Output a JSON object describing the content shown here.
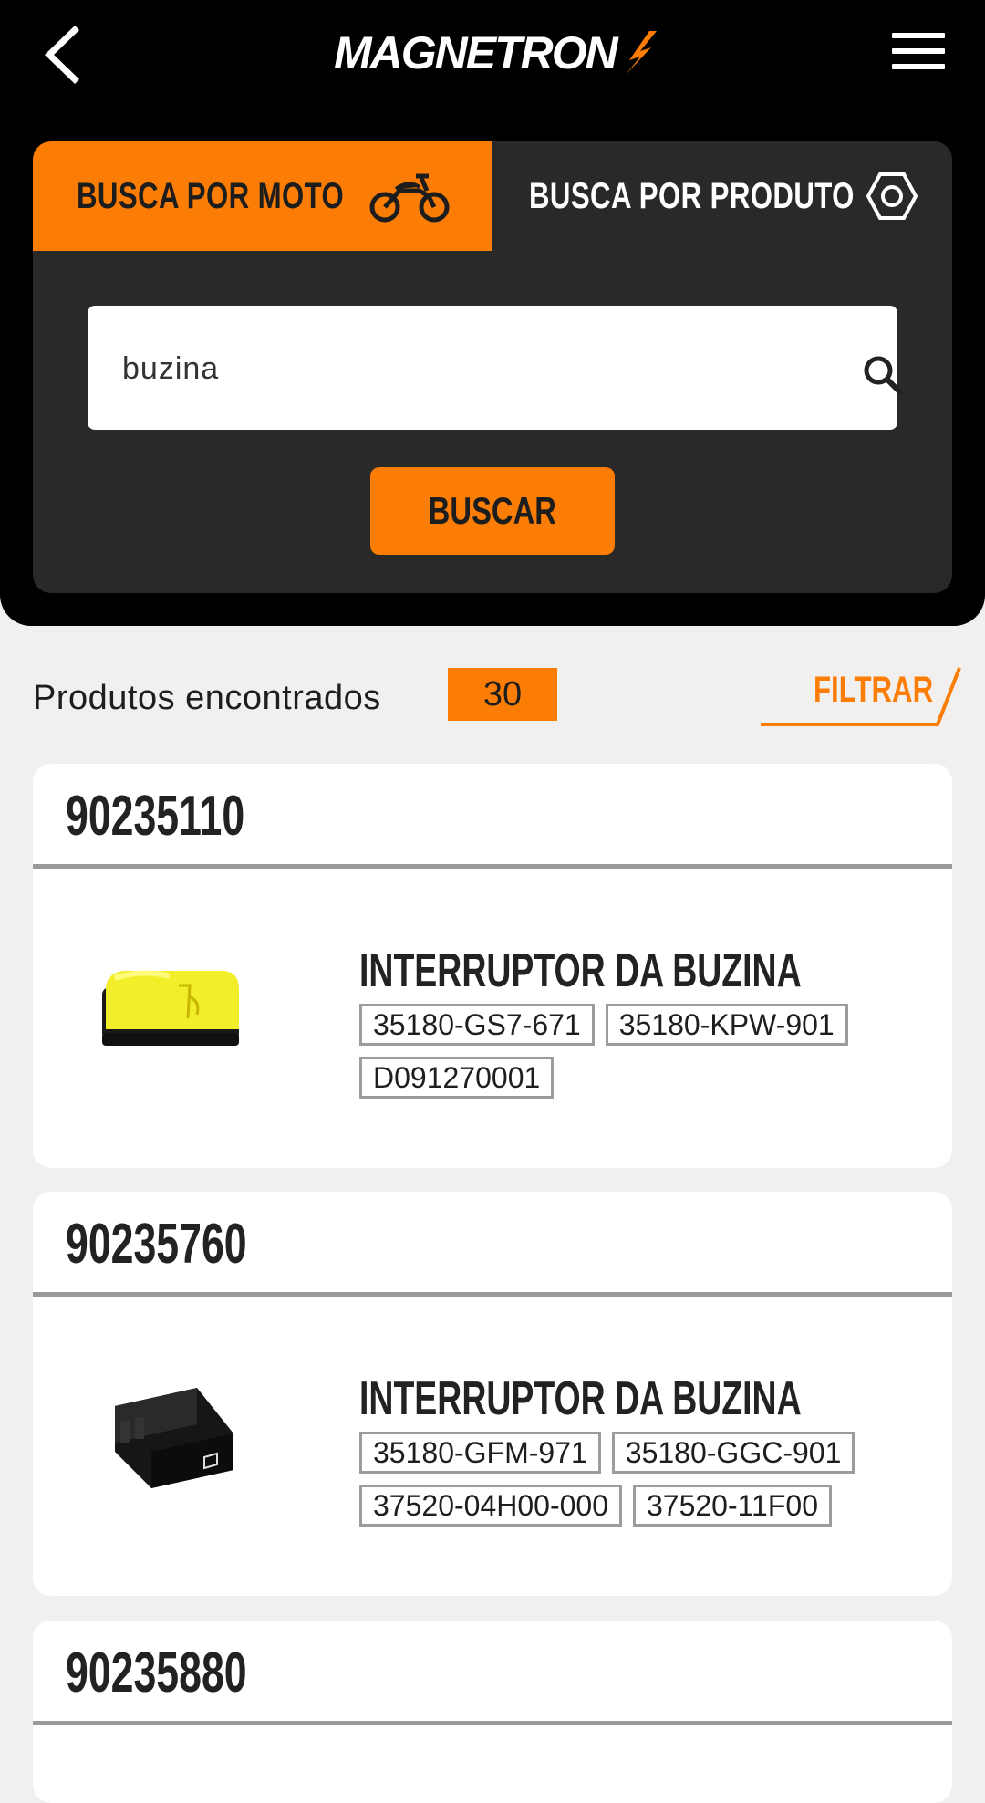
{
  "header": {
    "logo_text": "MAGNETRON",
    "brand_color": "#fb7d06"
  },
  "tabs": {
    "moto_label": "BUSCA POR MOTO",
    "produto_label": "BUSCA POR PRODUTO",
    "active": "moto"
  },
  "search": {
    "value": "buzina",
    "button_label": "BUSCAR"
  },
  "results": {
    "label": "Produtos encontrados",
    "count": "30",
    "filter_label": "FILTRAR"
  },
  "products": [
    {
      "code": "90235110",
      "title": "INTERRUPTOR DA BUZINA",
      "image": "yellow-horn-switch",
      "refs": [
        "35180-GS7-671",
        "35180-KPW-901",
        "D091270001"
      ]
    },
    {
      "code": "90235760",
      "title": "INTERRUPTOR DA BUZINA",
      "image": "black-horn-switch",
      "refs": [
        "35180-GFM-971",
        "35180-GGC-901",
        "37520-04H00-000",
        "37520-11F00"
      ]
    },
    {
      "code": "90235880"
    }
  ]
}
